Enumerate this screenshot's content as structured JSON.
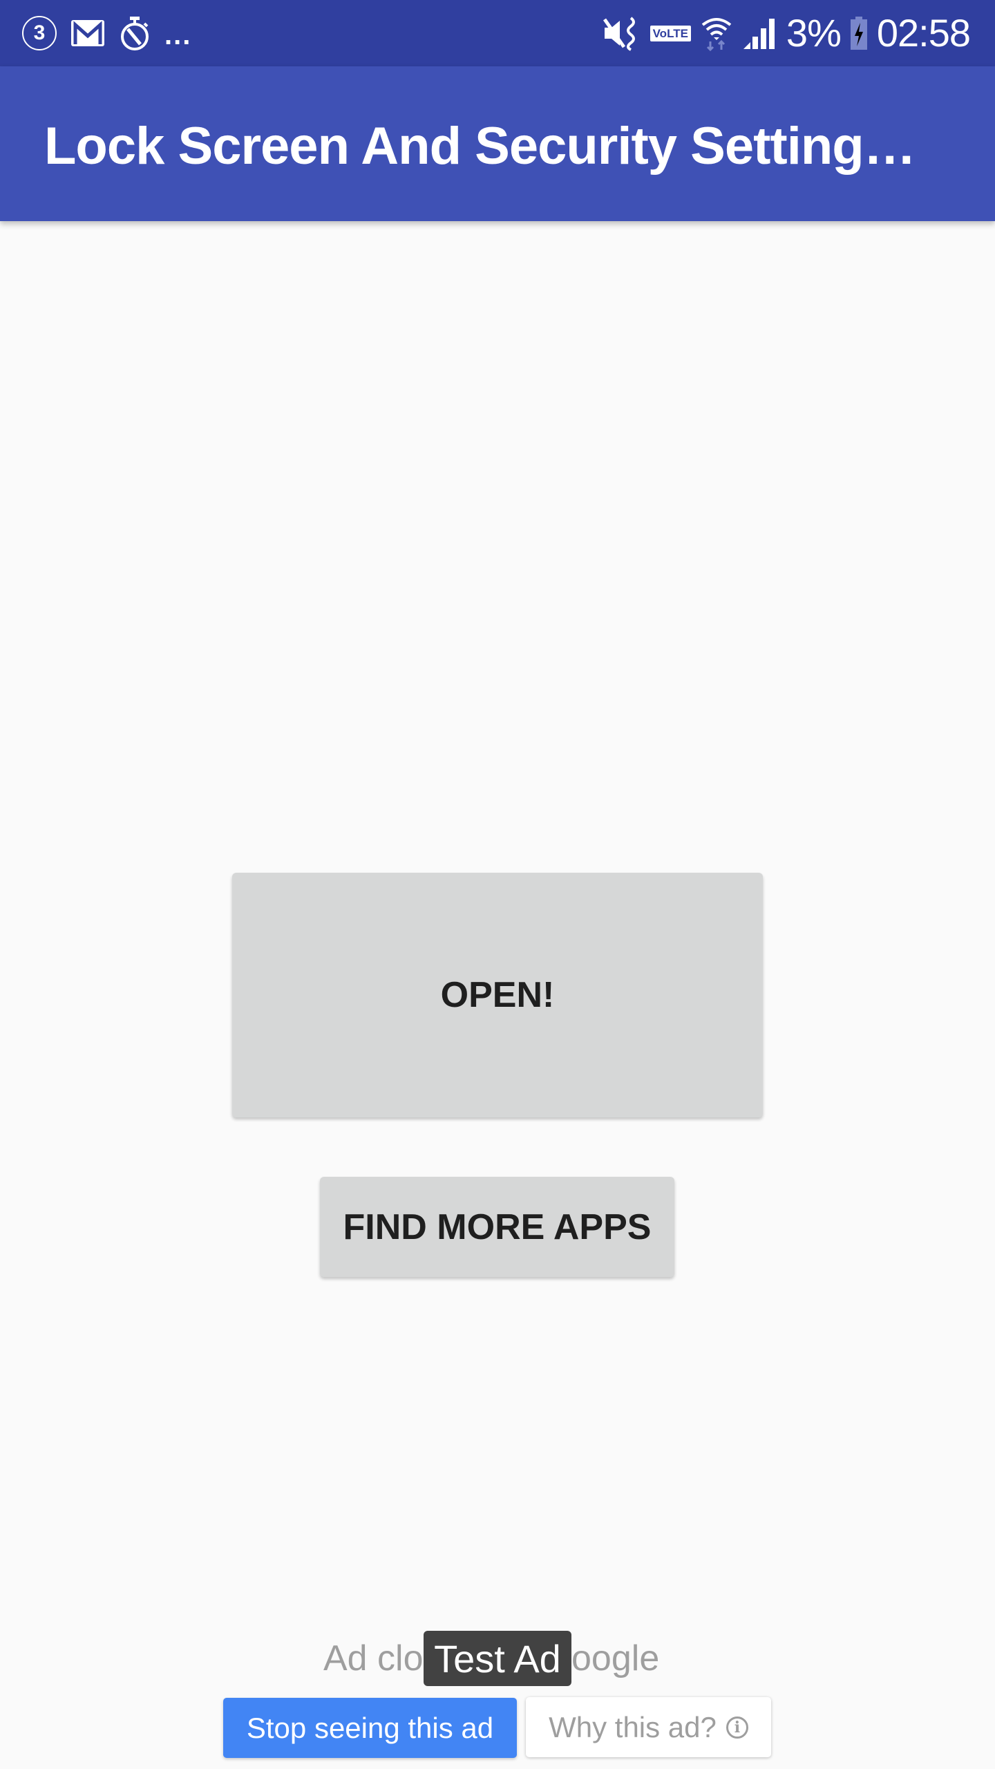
{
  "status_bar": {
    "notification_count": "3",
    "overflow": "...",
    "volte_label": "VoLTE",
    "battery_percent": "3%",
    "time": "02:58",
    "icons_left": [
      "notification-count-icon",
      "gmail-icon",
      "timer-icon"
    ],
    "icons_right": [
      "mute-vibrate-icon",
      "volte-icon",
      "wifi-icon",
      "signal-icon",
      "battery-charging-icon"
    ]
  },
  "app_bar": {
    "title": "Lock Screen And Security Setting…",
    "color": "#3f51b5"
  },
  "main": {
    "open_button": "OPEN!",
    "find_more_button": "FIND MORE APPS"
  },
  "ad": {
    "text_left": "Ad clo",
    "text_right": "oogle",
    "test_badge": "Test Ad",
    "stop_button": "Stop seeing this ad",
    "why_button": "Why this ad?",
    "stop_color": "#4285f4"
  }
}
